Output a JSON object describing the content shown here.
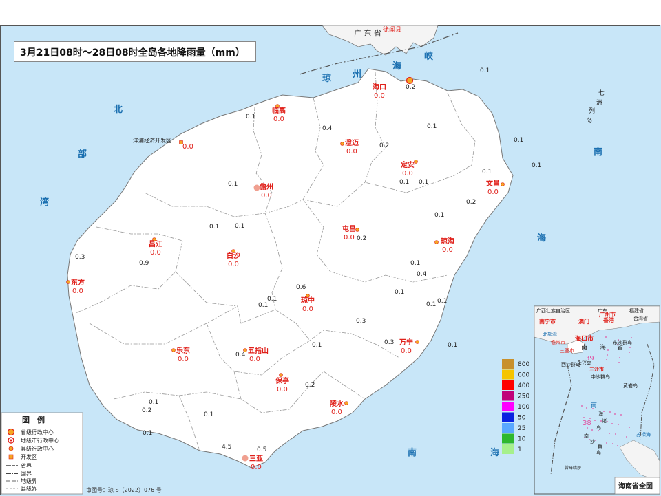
{
  "title": "3月21日08时～28日08时全岛各地降雨量（mm）",
  "neighbor": {
    "province_top": "广 东 省",
    "xuwen": "徐闻县"
  },
  "sea_labels": [
    "琼",
    "州",
    "海",
    "峡",
    "北",
    "部",
    "湾",
    "南",
    "海",
    "南",
    "海",
    "七",
    "洲",
    "列",
    "岛"
  ],
  "cities": [
    {
      "name": "海口",
      "value": "0.0",
      "extra": "0.2"
    },
    {
      "name": "临高",
      "value": "0.0"
    },
    {
      "name": "洋浦经济开发区",
      "value": "0.0"
    },
    {
      "name": "澄迈",
      "value": "0.0"
    },
    {
      "name": "定安",
      "value": "0.0"
    },
    {
      "name": "文昌",
      "value": "0.0"
    },
    {
      "name": "儋州",
      "value": "0.0"
    },
    {
      "name": "屯昌",
      "value": "0.0"
    },
    {
      "name": "琼海",
      "value": "0.0"
    },
    {
      "name": "昌江",
      "value": "0.0"
    },
    {
      "name": "白沙",
      "value": "0.0"
    },
    {
      "name": "东方",
      "value": "0.0"
    },
    {
      "name": "琼中",
      "value": "0.0"
    },
    {
      "name": "万宁",
      "value": "0.0"
    },
    {
      "name": "乐东",
      "value": "0.0"
    },
    {
      "name": "五指山",
      "value": "0.0"
    },
    {
      "name": "保亭",
      "value": "0.0"
    },
    {
      "name": "陵水",
      "value": "0.0"
    },
    {
      "name": "三亚",
      "value": "0.0"
    }
  ],
  "station_values": [
    "0.1",
    "0.4",
    "0.1",
    "0.1",
    "0.2",
    "0.1",
    "0.1",
    "0.1",
    "0.1",
    "0.2",
    "0.1",
    "0.1",
    "0.3",
    "0.9",
    "0.1",
    "0.6",
    "0.1",
    "0.1",
    "0.1",
    "0.4",
    "0.1",
    "0.1",
    "0.1",
    "0.3",
    "0.3",
    "0.1",
    "0.4",
    "0.1",
    "0.2",
    "0.2",
    "0.1",
    "4.5",
    "0.5",
    "0.1",
    "0.1",
    "0.1",
    "0.1",
    "0.2"
  ],
  "legend": {
    "title": "图　例",
    "items": [
      "省级行政中心",
      "地级市行政中心",
      "县级行政中心",
      "开发区",
      "省界",
      "国界",
      "地级界",
      "县级界"
    ]
  },
  "colorscale": [
    {
      "label": "800",
      "color": "#c8902c"
    },
    {
      "label": "600",
      "color": "#f5c400"
    },
    {
      "label": "400",
      "color": "#ff0000"
    },
    {
      "label": "250",
      "color": "#c0007a"
    },
    {
      "label": "100",
      "color": "#ff00ff"
    },
    {
      "label": "50",
      "color": "#0a22e0"
    },
    {
      "label": "25",
      "color": "#5aa8ff"
    },
    {
      "label": "10",
      "color": "#2eb82e"
    },
    {
      "label": "1",
      "color": "#a6f08c"
    }
  ],
  "footer": "审图号：琼 S（2022）076 号",
  "inset": {
    "title": "海南省全图",
    "labels": [
      "广西壮族自治区",
      "广东",
      "福建省",
      "南宁市",
      "澳门",
      "广州市",
      "香港",
      "台湾省",
      "海口市",
      "儋州市",
      "北部湾",
      "南",
      "海",
      "省",
      "西沙群岛",
      "东沙群岛",
      "三亚市",
      "永兴岛",
      "三沙市",
      "中沙群岛",
      "黄岩岛",
      "南",
      "海",
      "诸",
      "岛",
      "南",
      "沙",
      "群",
      "岛",
      "曾母暗沙",
      "苏禄海"
    ],
    "numbers": [
      "39",
      "38"
    ]
  }
}
